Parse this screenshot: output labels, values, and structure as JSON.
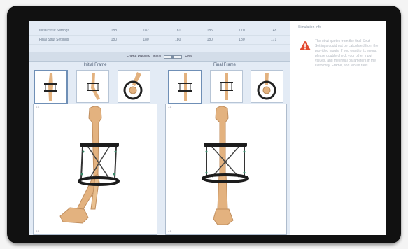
{
  "strut_table": {
    "rows": [
      {
        "label": "Initial Strut Settings",
        "values": [
          "188",
          "182",
          "181",
          "185",
          "170",
          "148"
        ]
      },
      {
        "label": "Final Strut Settings",
        "values": [
          "180",
          "180",
          "180",
          "180",
          "180",
          "171"
        ]
      }
    ]
  },
  "frame_preview": {
    "label": "Frame Preview",
    "left_word": "Initial",
    "right_word": "Final"
  },
  "initial_frame": {
    "title": "Initial Frame",
    "corner_label": "AP",
    "footer_label": "AP"
  },
  "final_frame": {
    "title": "Final Frame",
    "corner_label": "AP",
    "footer_label": "AP"
  },
  "thumb_labels": [
    "AP",
    "LAT",
    "AX"
  ],
  "message_panel": {
    "title": "Simulation Info",
    "text": "The strut quotes from the final Strut Settings could not be calculated from the provided inputs. If you want to fix errors, please double check your other input values, and the initial parameters in the Deformity, Frame, and Mount tabs."
  },
  "colors": {
    "accent": "#6f8fb6",
    "warning": "#e2492f",
    "bone": "#e3b27f",
    "panel": "#e3ebf5"
  },
  "icons": {
    "warning": "warning-triangle-icon"
  }
}
